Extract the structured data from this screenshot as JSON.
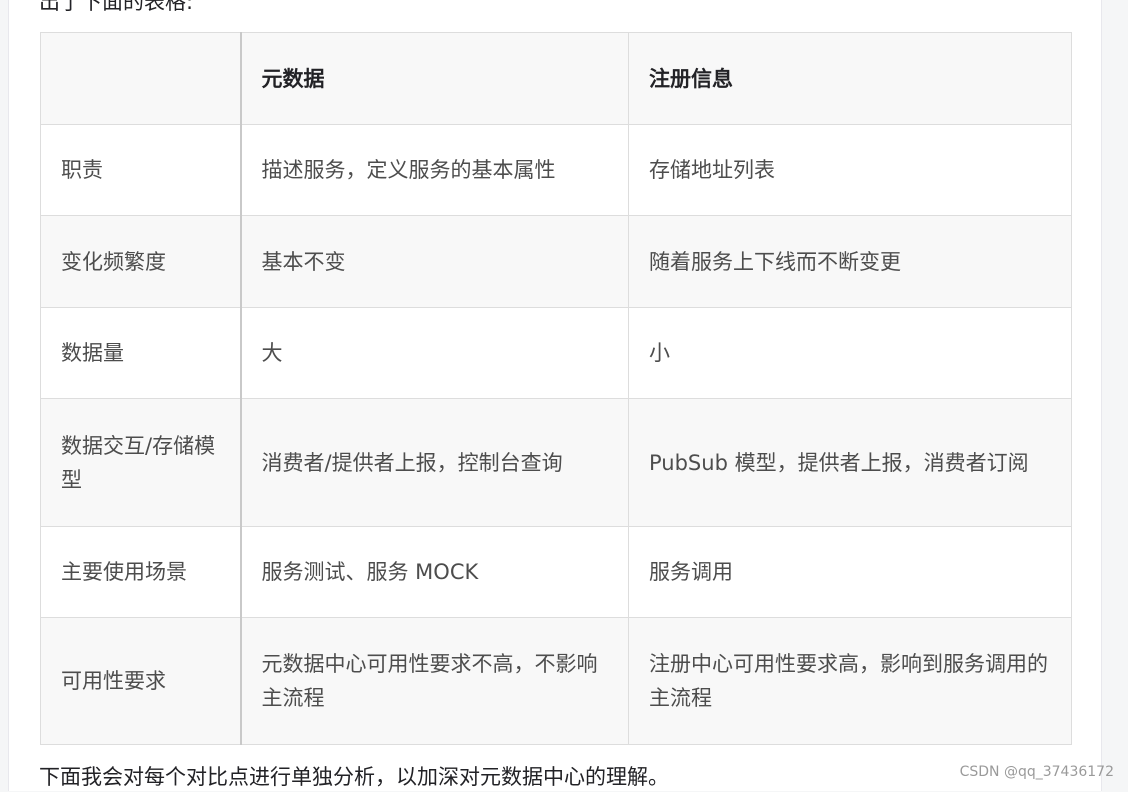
{
  "article": {
    "intro_text": "出了下面的表格:",
    "outro_text": "下面我会对每个对比点进行单独分析，以加深对元数据中心的理解。",
    "watermark": "CSDN @qq_37436172"
  },
  "table": {
    "headers": [
      "",
      "元数据",
      "注册信息"
    ],
    "rows": [
      [
        "职责",
        "描述服务，定义服务的基本属性",
        "存储地址列表"
      ],
      [
        "变化频繁度",
        "基本不变",
        "随着服务上下线而不断变更"
      ],
      [
        "数据量",
        "大",
        "小"
      ],
      [
        "数据交互/存储模型",
        "消费者/提供者上报，控制台查询",
        "PubSub 模型，提供者上报，消费者订阅"
      ],
      [
        "主要使用场景",
        "服务测试、服务 MOCK",
        "服务调用"
      ],
      [
        "可用性要求",
        "元数据中心可用性要求不高，不影响主流程",
        "注册中心可用性要求高，影响到服务调用的主流程"
      ]
    ]
  }
}
